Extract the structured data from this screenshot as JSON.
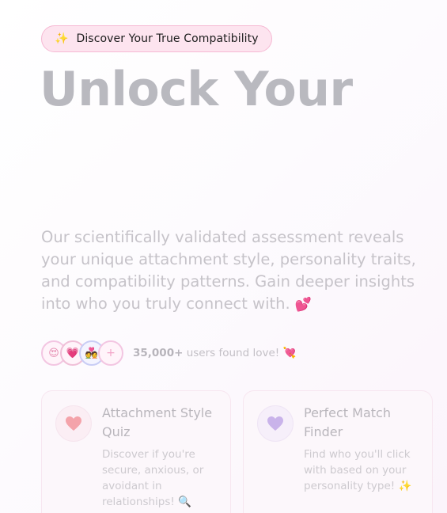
{
  "badge": {
    "icon": "sparkles-icon",
    "sparkle": "✨",
    "text": "Discover Your True Compatibility"
  },
  "hero": {
    "title": "Unlock Your",
    "description": "Our scientifically validated assessment reveals your unique attachment style, personality traits, and compatibility patterns. Gain deeper insights into who you truly connect with.",
    "description_emoji": "💕"
  },
  "social_proof": {
    "avatars": [
      "😍",
      "💗",
      "💑",
      "+"
    ],
    "count": "35,000+",
    "text": " users found love! ",
    "emoji": "💘"
  },
  "cards": [
    {
      "icon": "heart-icon",
      "title": "Attachment Style Quiz",
      "description": "Discover if you're secure, anxious, or avoidant in relationships!",
      "emoji": "🔍",
      "icon_color": "#f4a3aa"
    },
    {
      "icon": "purple-heart-icon",
      "title": "Perfect Match Finder",
      "description": "Find who you'll click with based on your personality type!",
      "emoji": "✨",
      "icon_color": "#c9b3ea"
    }
  ],
  "colors": {
    "badge_bg": "#fde4ef",
    "badge_border": "#f6b8d3",
    "title": "#b9b9bf",
    "body_text": "#c6c3c9"
  }
}
